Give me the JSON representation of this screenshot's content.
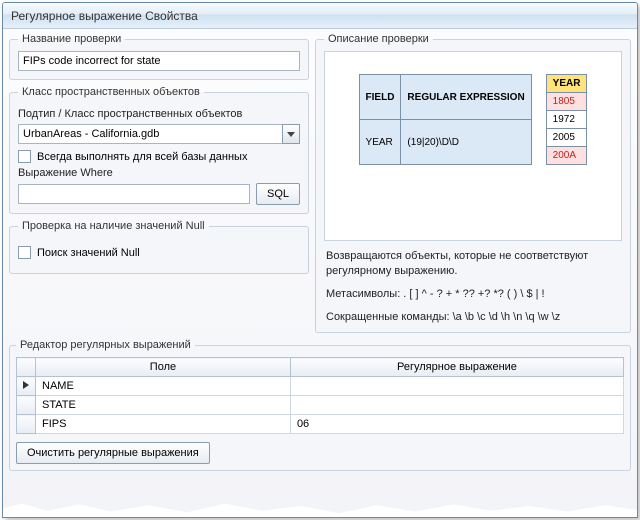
{
  "window": {
    "title": "Регулярное выражение Свойства"
  },
  "left": {
    "checkName": {
      "legend": "Название проверки",
      "value": "FIPs code incorrect for state"
    },
    "featureClass": {
      "legend": "Класс пространственных объектов",
      "subtype_label": "Подтип / Класс пространственных объектов",
      "combo_value": "UrbanAreas -  California.gdb",
      "always_label": "Всегда выполнять для всей базы данных",
      "where_label": "Выражение Where",
      "where_value": "",
      "sql_btn": "SQL"
    },
    "nullCheck": {
      "legend": "Проверка на наличие значений Null",
      "search_label": "Поиск значений Null"
    }
  },
  "right": {
    "legend": "Описание проверки",
    "diag": {
      "t1": {
        "h1": "FIELD",
        "h2": "REGULAR EXPRESSION",
        "r1": "YEAR",
        "r2": "(19|20)\\D\\D"
      },
      "t2": {
        "hdr": "YEAR",
        "v1": "1805",
        "v2": "1972",
        "v3": "2005",
        "v4": "200A"
      }
    },
    "line1": "Возвращаются объекты, которые не соответствуют регулярному выражению.",
    "line2": "Метасимволы: . [ ] ^ - ? + * ?? +? *? ( ) \\ $ | !",
    "line3": "Сокращенные команды: \\a \\b \\c \\d \\h \\n \\q \\w \\z"
  },
  "editor": {
    "legend": "Редактор регулярных выражений",
    "col_field": "Поле",
    "col_regex": "Регулярное выражение",
    "rows": [
      {
        "field": "NAME",
        "regex": ""
      },
      {
        "field": "STATE",
        "regex": ""
      },
      {
        "field": "FIPS",
        "regex": "06"
      }
    ],
    "clear_btn": "Очистить регулярные выражения"
  }
}
